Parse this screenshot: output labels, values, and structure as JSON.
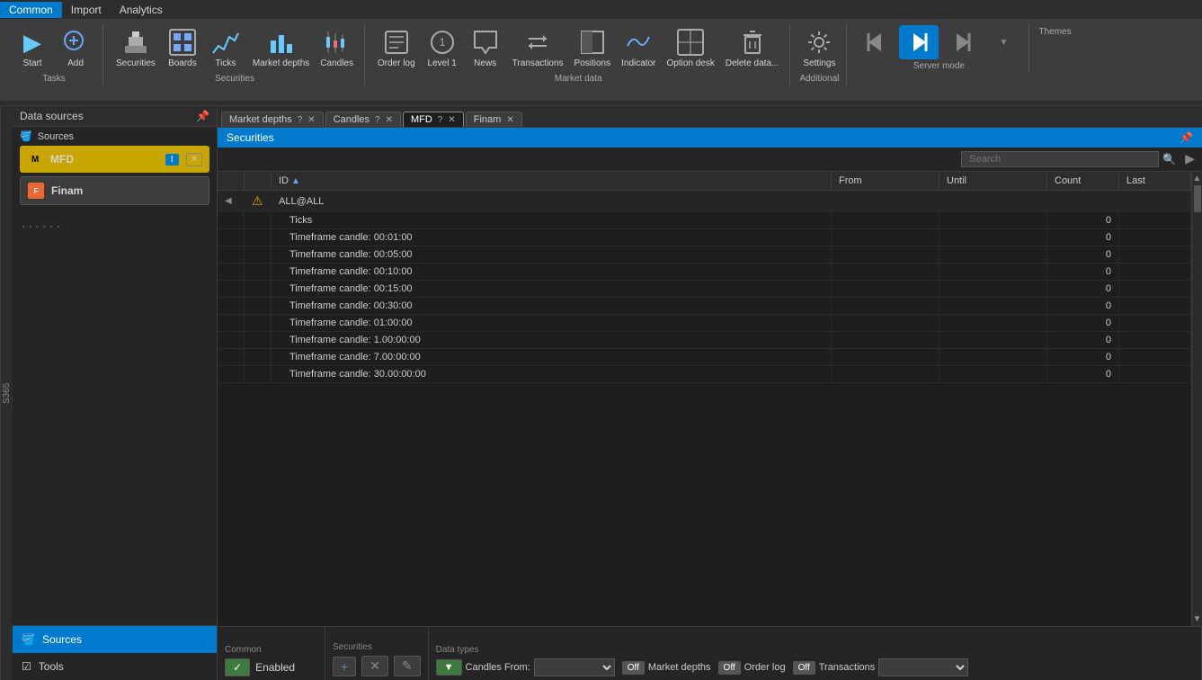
{
  "menubar": {
    "items": [
      "Common",
      "Import",
      "Analytics"
    ]
  },
  "ribbon": {
    "groups": [
      {
        "label": "Tasks",
        "buttons": [
          {
            "id": "start",
            "label": "Start",
            "icon": "▶"
          },
          {
            "id": "add",
            "label": "Add",
            "icon": "+"
          }
        ]
      },
      {
        "label": "Securities",
        "buttons": [
          {
            "id": "securities",
            "label": "Securities",
            "icon": "🏛"
          },
          {
            "id": "boards",
            "label": "Boards",
            "icon": "📋"
          },
          {
            "id": "ticks",
            "label": "Ticks",
            "icon": "📊"
          },
          {
            "id": "market-depths",
            "label": "Market\ndepths",
            "icon": "📉"
          },
          {
            "id": "candles",
            "label": "Candles",
            "icon": "📈"
          }
        ]
      },
      {
        "label": "Market data",
        "buttons": [
          {
            "id": "order-log",
            "label": "Order\nlog",
            "icon": "📝"
          },
          {
            "id": "level1",
            "label": "Level\n1",
            "icon": "①"
          },
          {
            "id": "news",
            "label": "News",
            "icon": "✉"
          },
          {
            "id": "transactions",
            "label": "Transactions",
            "icon": "⇄"
          },
          {
            "id": "positions",
            "label": "Positions",
            "icon": "◧"
          },
          {
            "id": "indicator",
            "label": "Indicator",
            "icon": "∿"
          },
          {
            "id": "option-desk",
            "label": "Option\ndesk",
            "icon": "⊞"
          },
          {
            "id": "delete-data",
            "label": "Delete\ndata...",
            "icon": "🗑"
          }
        ]
      },
      {
        "label": "Additional",
        "buttons": [
          {
            "id": "settings",
            "label": "Settings",
            "icon": "⚙"
          }
        ]
      },
      {
        "label": "Server mode",
        "buttons": [
          {
            "id": "theme1",
            "label": "",
            "icon": "◁"
          },
          {
            "id": "theme2",
            "label": "",
            "icon": "▷",
            "highlighted": true
          },
          {
            "id": "theme3",
            "label": "",
            "icon": "▷"
          }
        ]
      },
      {
        "label": "Themes",
        "buttons": []
      }
    ]
  },
  "sidebar": {
    "header": "Data sources",
    "sources_label": "Sources",
    "sources": [
      {
        "id": "mfd",
        "name": "MFD",
        "active": true,
        "enabled": true
      },
      {
        "id": "finam",
        "name": "Finam",
        "active": false,
        "enabled": false
      }
    ],
    "bottom": [
      {
        "id": "sources-bottom",
        "label": "Sources",
        "active": true
      },
      {
        "id": "tools",
        "label": "Tools",
        "active": false
      }
    ]
  },
  "tabs": [
    {
      "id": "market-depths",
      "label": "Market depths",
      "closable": true
    },
    {
      "id": "candles",
      "label": "Candles",
      "closable": true
    },
    {
      "id": "mfd",
      "label": "MFD",
      "closable": true,
      "active": true
    },
    {
      "id": "finam",
      "label": "Finam",
      "closable": true
    }
  ],
  "securities": {
    "header": "Securities",
    "search_placeholder": "Search",
    "columns": [
      {
        "id": "expand",
        "label": ""
      },
      {
        "id": "warn",
        "label": ""
      },
      {
        "id": "id",
        "label": "ID",
        "sortable": true
      },
      {
        "id": "from",
        "label": "From"
      },
      {
        "id": "until",
        "label": "Until"
      },
      {
        "id": "count",
        "label": "Count"
      },
      {
        "id": "last",
        "label": "Last"
      }
    ],
    "rows": [
      {
        "id": "group",
        "expand": "◀",
        "warn": "⚠",
        "name": "ALL@ALL",
        "from": "",
        "until": "",
        "count": "",
        "last": "",
        "is_group": true
      },
      {
        "id": "ticks",
        "name": "Ticks",
        "from": "",
        "until": "",
        "count": "0",
        "last": ""
      },
      {
        "id": "tc1",
        "name": "Timeframe candle: 00:01:00",
        "from": "",
        "until": "",
        "count": "0",
        "last": ""
      },
      {
        "id": "tc2",
        "name": "Timeframe candle: 00:05:00",
        "from": "",
        "until": "",
        "count": "0",
        "last": ""
      },
      {
        "id": "tc3",
        "name": "Timeframe candle: 00:10:00",
        "from": "",
        "until": "",
        "count": "0",
        "last": ""
      },
      {
        "id": "tc4",
        "name": "Timeframe candle: 00:15:00",
        "from": "",
        "until": "",
        "count": "0",
        "last": ""
      },
      {
        "id": "tc5",
        "name": "Timeframe candle: 00:30:00",
        "from": "",
        "until": "",
        "count": "0",
        "last": ""
      },
      {
        "id": "tc6",
        "name": "Timeframe candle: 01:00:00",
        "from": "",
        "until": "",
        "count": "0",
        "last": ""
      },
      {
        "id": "tc7",
        "name": "Timeframe candle: 1.00:00:00",
        "from": "",
        "until": "",
        "count": "0",
        "last": ""
      },
      {
        "id": "tc8",
        "name": "Timeframe candle: 7.00:00:00",
        "from": "",
        "until": "",
        "count": "0",
        "last": ""
      },
      {
        "id": "tc9",
        "name": "Timeframe candle: 30.00:00:00",
        "from": "",
        "until": "",
        "count": "0",
        "last": ""
      }
    ]
  },
  "bottom_panel": {
    "common_label": "Common",
    "enabled_label": "Enabled",
    "enabled_on": true,
    "securities_label": "Securities",
    "add_btn": "+",
    "del_btn": "✕",
    "edit_btn": "✎",
    "data_types_label": "Data types",
    "candles_from_label": "Candles From:",
    "candles_from_placeholder": "",
    "market_depths_label": "Market depths",
    "market_depths_state": "Off",
    "order_log_label": "Order log",
    "order_log_state": "Off",
    "transactions_label": "Transactions",
    "transactions_state": "Off"
  }
}
